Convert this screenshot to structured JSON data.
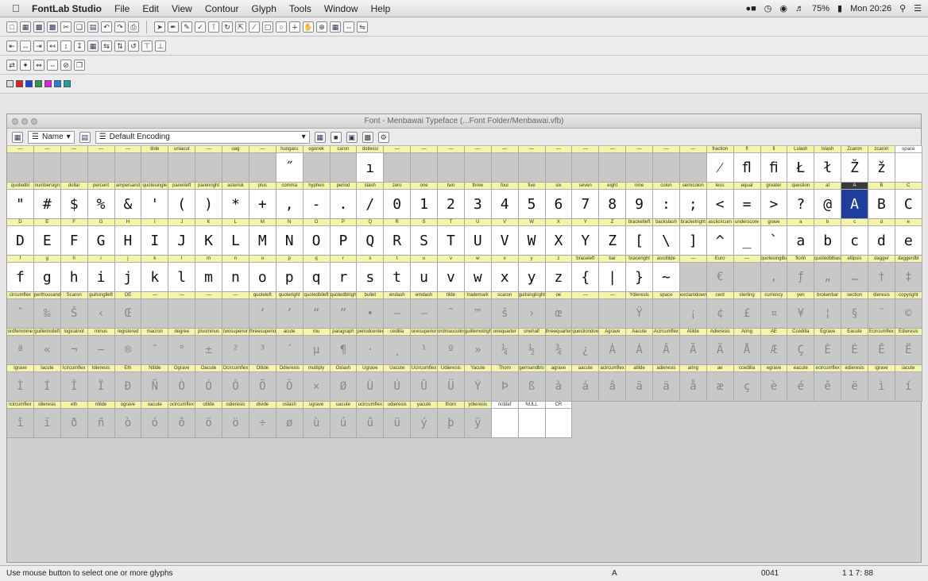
{
  "menubar": {
    "app": "FontLab Studio",
    "items": [
      "File",
      "Edit",
      "View",
      "Contour",
      "Glyph",
      "Tools",
      "Window",
      "Help"
    ],
    "battery": "75%",
    "clock": "Mon 20:26"
  },
  "window": {
    "title": "Font - Menbawai Typeface (...Font Folder/Menbawai.vfb)",
    "name_mode": "Name",
    "encoding": "Default Encoding"
  },
  "colors": {
    "label_bg": "#f5f5a8",
    "selected": "#1f3fa0",
    "swatches": [
      "#dddddd",
      "#e02020",
      "#2040e0",
      "#20a040",
      "#e020e0",
      "#2080e0",
      "#20a0a0"
    ]
  },
  "glyph_rows": [
    {
      "labels": [
        "—",
        "—",
        "—",
        "—",
        "—",
        "tilde",
        "uniacut",
        "—",
        "uag",
        "—",
        "hungaru",
        "ogonek",
        "caron",
        "dotlessi",
        "—",
        "—",
        "—",
        "—",
        "—",
        "—",
        "—",
        "—",
        "—",
        "—",
        "—",
        "—",
        "fraction",
        "fl",
        "fi",
        "Lslash",
        "lslash",
        "Zcaron",
        "zcaron",
        "space"
      ],
      "glyphs": [
        "",
        "",
        "",
        "",
        "",
        "",
        "",
        "",
        "",
        "",
        "˝",
        "",
        "",
        "ı",
        "",
        "",
        "",
        "",
        "",
        "",
        "",
        "",
        "",
        "",
        "",
        "",
        "⁄",
        "ﬂ",
        "ﬁ",
        "Ł",
        "ł",
        "Ž",
        "ž",
        ""
      ],
      "kind": [
        "e",
        "e",
        "e",
        "e",
        "e",
        "e",
        "e",
        "e",
        "e",
        "e",
        "f",
        "e",
        "e",
        "f",
        "e",
        "e",
        "e",
        "e",
        "e",
        "e",
        "e",
        "e",
        "e",
        "e",
        "e",
        "e",
        "f",
        "f",
        "f",
        "f",
        "f",
        "f",
        "f",
        "b"
      ]
    },
    {
      "labels": [
        "quotedbl",
        "numbersign",
        "dollar",
        "percent",
        "ampersand",
        "quotesingle",
        "parenleft",
        "parenright",
        "asterisk",
        "plus",
        "comma",
        "hyphen",
        "period",
        "slash",
        "zero",
        "one",
        "two",
        "three",
        "four",
        "five",
        "six",
        "seven",
        "eight",
        "nine",
        "colon",
        "semicolon",
        "less",
        "equal",
        "greater",
        "question",
        "at",
        "A",
        "B",
        "C"
      ],
      "glyphs": [
        "\"",
        "#",
        "$",
        "%",
        "&",
        "'",
        "(",
        ")",
        "*",
        "+",
        ",",
        "-",
        ".",
        "/",
        "0",
        "1",
        "2",
        "3",
        "4",
        "5",
        "6",
        "7",
        "8",
        "9",
        ":",
        ";",
        "<",
        "=",
        ">",
        "?",
        "@",
        "A",
        "B",
        "C"
      ],
      "kind": [
        "f",
        "f",
        "f",
        "f",
        "f",
        "f",
        "f",
        "f",
        "f",
        "f",
        "f",
        "f",
        "f",
        "f",
        "f",
        "f",
        "f",
        "f",
        "f",
        "f",
        "f",
        "f",
        "f",
        "f",
        "f",
        "f",
        "f",
        "f",
        "f",
        "f",
        "f",
        "s",
        "f",
        "f"
      ]
    },
    {
      "labels": [
        "D",
        "E",
        "F",
        "G",
        "H",
        "I",
        "J",
        "K",
        "L",
        "M",
        "N",
        "O",
        "P",
        "Q",
        "R",
        "S",
        "T",
        "U",
        "V",
        "W",
        "X",
        "Y",
        "Z",
        "bracketleft",
        "backslash",
        "bracketright",
        "asciicircum",
        "underscore",
        "grave",
        "a",
        "b",
        "c",
        "d",
        "e"
      ],
      "glyphs": [
        "D",
        "E",
        "F",
        "G",
        "H",
        "I",
        "J",
        "K",
        "L",
        "M",
        "N",
        "O",
        "P",
        "Q",
        "R",
        "S",
        "T",
        "U",
        "V",
        "W",
        "X",
        "Y",
        "Z",
        "[",
        "\\",
        "]",
        "^",
        "_",
        "`",
        "a",
        "b",
        "c",
        "d",
        "e"
      ],
      "kind": [
        "f",
        "f",
        "f",
        "f",
        "f",
        "f",
        "f",
        "f",
        "f",
        "f",
        "f",
        "f",
        "f",
        "f",
        "f",
        "f",
        "f",
        "f",
        "f",
        "f",
        "f",
        "f",
        "f",
        "f",
        "f",
        "f",
        "f",
        "f",
        "f",
        "f",
        "f",
        "f",
        "f",
        "f"
      ]
    },
    {
      "labels": [
        "f",
        "g",
        "h",
        "i",
        "j",
        "k",
        "l",
        "m",
        "n",
        "o",
        "p",
        "q",
        "r",
        "s",
        "t",
        "u",
        "v",
        "w",
        "x",
        "y",
        "z",
        "braceleft",
        "bar",
        "braceright",
        "asciitilde",
        "—",
        "Euro",
        "—",
        "quotesinglbase",
        "florin",
        "quotedblbase",
        "ellipsis",
        "dagger",
        "daggerdbl"
      ],
      "glyphs": [
        "f",
        "g",
        "h",
        "i",
        "j",
        "k",
        "l",
        "m",
        "n",
        "o",
        "p",
        "q",
        "r",
        "s",
        "t",
        "u",
        "v",
        "w",
        "x",
        "y",
        "z",
        "{",
        "|",
        "}",
        "~",
        "",
        "€",
        "",
        "‚",
        "ƒ",
        "„",
        "…",
        "†",
        "‡"
      ],
      "kind": [
        "f",
        "f",
        "f",
        "f",
        "f",
        "f",
        "f",
        "f",
        "f",
        "f",
        "f",
        "f",
        "f",
        "f",
        "f",
        "f",
        "f",
        "f",
        "f",
        "f",
        "f",
        "f",
        "f",
        "f",
        "f",
        "e",
        "x",
        "e",
        "x",
        "x",
        "x",
        "x",
        "x",
        "x"
      ]
    },
    {
      "labels": [
        "circumflex",
        "perthousand",
        "Scaron",
        "guilsinglleft",
        "OE",
        "—",
        "—",
        "—",
        "—",
        "quoteleft",
        "quoteright",
        "quotedblleft",
        "quotedblright",
        "bullet",
        "endash",
        "emdash",
        "tilde",
        "trademark",
        "scaron",
        "guilsinglright",
        "oe",
        "—",
        "—",
        "Ydieresis",
        "space",
        "exclamdown",
        "cent",
        "sterling",
        "currency",
        "yen",
        "brokenbar",
        "section",
        "dieresis",
        "copyright"
      ],
      "glyphs": [
        "ˆ",
        "‰",
        "Š",
        "‹",
        "Œ",
        "",
        "",
        "",
        "",
        "‘",
        "’",
        "“",
        "”",
        "•",
        "–",
        "—",
        "˜",
        "™",
        "š",
        "›",
        "œ",
        "",
        "",
        "Ÿ",
        "",
        "¡",
        "¢",
        "£",
        "¤",
        "¥",
        "¦",
        "§",
        "¨",
        "©"
      ],
      "kind": [
        "x",
        "x",
        "x",
        "x",
        "x",
        "e",
        "e",
        "e",
        "e",
        "x",
        "x",
        "x",
        "x",
        "x",
        "x",
        "x",
        "x",
        "x",
        "x",
        "x",
        "x",
        "e",
        "e",
        "x",
        "e",
        "x",
        "x",
        "x",
        "x",
        "x",
        "x",
        "x",
        "x",
        "x"
      ]
    },
    {
      "labels": [
        "ordfeminine",
        "guillemotleft",
        "logicalnot",
        "minus",
        "registered",
        "macron",
        "degree",
        "plusminus",
        "twosuperior",
        "threesuperior",
        "acute",
        "mu",
        "paragraph",
        "periodcentered",
        "cedilla",
        "onesuperior",
        "ordmasculine",
        "guillemotright",
        "onequarter",
        "onehalf",
        "threequarters",
        "questiondown",
        "Agrave",
        "Aacute",
        "Acircumflex",
        "Atilde",
        "Adieresis",
        "Aring",
        "AE",
        "Ccedilla",
        "Egrave",
        "Eacute",
        "Ecircumflex",
        "Edieresis"
      ],
      "glyphs": [
        "ª",
        "«",
        "¬",
        "−",
        "®",
        "¯",
        "°",
        "±",
        "²",
        "³",
        "´",
        "µ",
        "¶",
        "·",
        "¸",
        "¹",
        "º",
        "»",
        "¼",
        "½",
        "¾",
        "¿",
        "À",
        "Á",
        "Â",
        "Ã",
        "Ä",
        "Å",
        "Æ",
        "Ç",
        "È",
        "É",
        "Ê",
        "Ë"
      ],
      "kind": [
        "x",
        "x",
        "x",
        "x",
        "x",
        "x",
        "x",
        "x",
        "x",
        "x",
        "x",
        "x",
        "x",
        "x",
        "x",
        "x",
        "x",
        "x",
        "x",
        "x",
        "x",
        "x",
        "x",
        "x",
        "x",
        "x",
        "x",
        "x",
        "x",
        "x",
        "x",
        "x",
        "x",
        "x"
      ]
    },
    {
      "labels": [
        "Igrave",
        "Iacute",
        "Icircumflex",
        "Idieresis",
        "Eth",
        "Ntilde",
        "Ograve",
        "Oacute",
        "Ocircumflex",
        "Otilde",
        "Odieresis",
        "multiply",
        "Oslash",
        "Ugrave",
        "Uacute",
        "Ucircumflex",
        "Udieresis",
        "Yacute",
        "Thorn",
        "germandbls",
        "agrave",
        "aacute",
        "acircumflex",
        "atilde",
        "adieresis",
        "aring",
        "ae",
        "ccedilla",
        "egrave",
        "eacute",
        "ecircumflex",
        "edieresis",
        "igrave",
        "iacute"
      ],
      "glyphs": [
        "Ì",
        "Í",
        "Î",
        "Ï",
        "Ð",
        "Ñ",
        "Ò",
        "Ó",
        "Ô",
        "Õ",
        "Ö",
        "×",
        "Ø",
        "Ù",
        "Ú",
        "Û",
        "Ü",
        "Ý",
        "Þ",
        "ß",
        "à",
        "á",
        "â",
        "ã",
        "ä",
        "å",
        "æ",
        "ç",
        "è",
        "é",
        "ê",
        "ë",
        "ì",
        "í"
      ],
      "kind": [
        "x",
        "x",
        "x",
        "x",
        "x",
        "x",
        "x",
        "x",
        "x",
        "x",
        "x",
        "x",
        "x",
        "x",
        "x",
        "x",
        "x",
        "x",
        "x",
        "x",
        "x",
        "x",
        "x",
        "x",
        "x",
        "x",
        "x",
        "x",
        "x",
        "x",
        "x",
        "x",
        "x",
        "x"
      ]
    },
    {
      "labels": [
        "icircumflex",
        "idieresis",
        "eth",
        "ntilde",
        "ograve",
        "oacute",
        "ocircumflex",
        "otilde",
        "odieresis",
        "divide",
        "oslash",
        "ugrave",
        "uacute",
        "ucircumflex",
        "udieresis",
        "yacute",
        "thorn",
        "ydieresis",
        "notdef",
        "NULL",
        "CR"
      ],
      "glyphs": [
        "î",
        "ï",
        "ð",
        "ñ",
        "ò",
        "ó",
        "ô",
        "õ",
        "ö",
        "÷",
        "ø",
        "ù",
        "ú",
        "û",
        "ü",
        "ý",
        "þ",
        "ÿ",
        "",
        "",
        ""
      ],
      "kind": [
        "x",
        "x",
        "x",
        "x",
        "x",
        "x",
        "x",
        "x",
        "x",
        "x",
        "x",
        "x",
        "x",
        "x",
        "x",
        "x",
        "x",
        "x",
        "b",
        "b",
        "b"
      ]
    }
  ],
  "status": {
    "hint": "Use mouse button to select one or more glyphs",
    "glyph": "A",
    "code": "0041",
    "position": "1 1 7: 88"
  }
}
